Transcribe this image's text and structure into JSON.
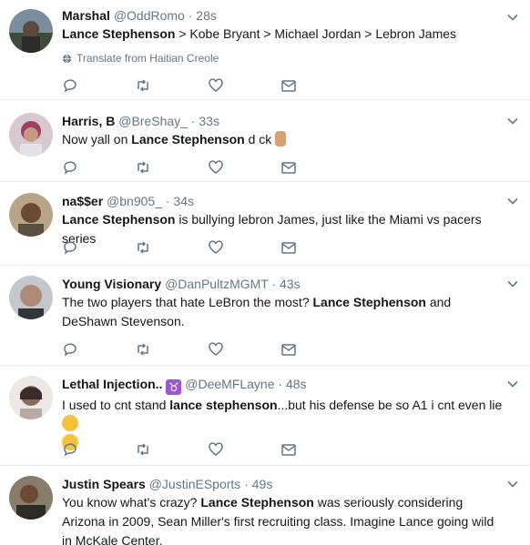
{
  "tweets": [
    {
      "name": "Marshal",
      "handle": "@OddRomo",
      "time": "· 28s",
      "parts": [
        {
          "t": "Lance Stephenson",
          "b": true
        },
        {
          "t": " > Kobe Bryant > Michael Jordan > Lebron James",
          "b": false
        }
      ],
      "translate": "Translate from Haitian Creole"
    },
    {
      "name": "Harris, B",
      "handle": "@BreShay_",
      "time": "· 33s",
      "parts": [
        {
          "t": "Now yall on ",
          "b": false
        },
        {
          "t": "Lance Stephenson",
          "b": true
        },
        {
          "t": " d ck ",
          "b": false
        }
      ],
      "emoji": "middle-finger"
    },
    {
      "name": "na$$er",
      "handle": "@bn905_",
      "time": "· 34s",
      "parts": [
        {
          "t": "Lance Stephenson",
          "b": true
        },
        {
          "t": " is bullying lebron James, just like the Miami vs pacers series",
          "b": false
        }
      ]
    },
    {
      "name": "Young Visionary",
      "handle": "@DanPultzMGMT",
      "time": "· 43s",
      "parts": [
        {
          "t": "The two players that hate LeBron the most? ",
          "b": false
        },
        {
          "t": "Lance Stephenson",
          "b": true
        },
        {
          "t": " and DeShawn Stevenson.",
          "b": false
        }
      ]
    },
    {
      "name": "Lethal Injection..",
      "name_icon": "taurus",
      "handle": "@DeeMFLayne",
      "time": "· 48s",
      "parts": [
        {
          "t": "I used to cnt stand ",
          "b": false
        },
        {
          "t": "lance stephenson",
          "b": true
        },
        {
          "t": "...but his defense be so A1 i cnt even lie ",
          "b": false
        }
      ],
      "emoji": "rolling-eyes-and-unamused"
    },
    {
      "name": "Justin Spears",
      "handle": "@JustinESports",
      "time": "· 49s",
      "parts": [
        {
          "t": "You know what's crazy? ",
          "b": false
        },
        {
          "t": "Lance Stephenson",
          "b": true
        },
        {
          "t": " was seriously considering Arizona in 2009, Sean Miller's first recruiting class. Imagine Lance going wild in McKale Center.",
          "b": false
        }
      ]
    }
  ],
  "colors": {
    "icon": "#657786",
    "text": "#14171a",
    "border": "#e6ecf0",
    "taurus": "#9b59d0"
  }
}
